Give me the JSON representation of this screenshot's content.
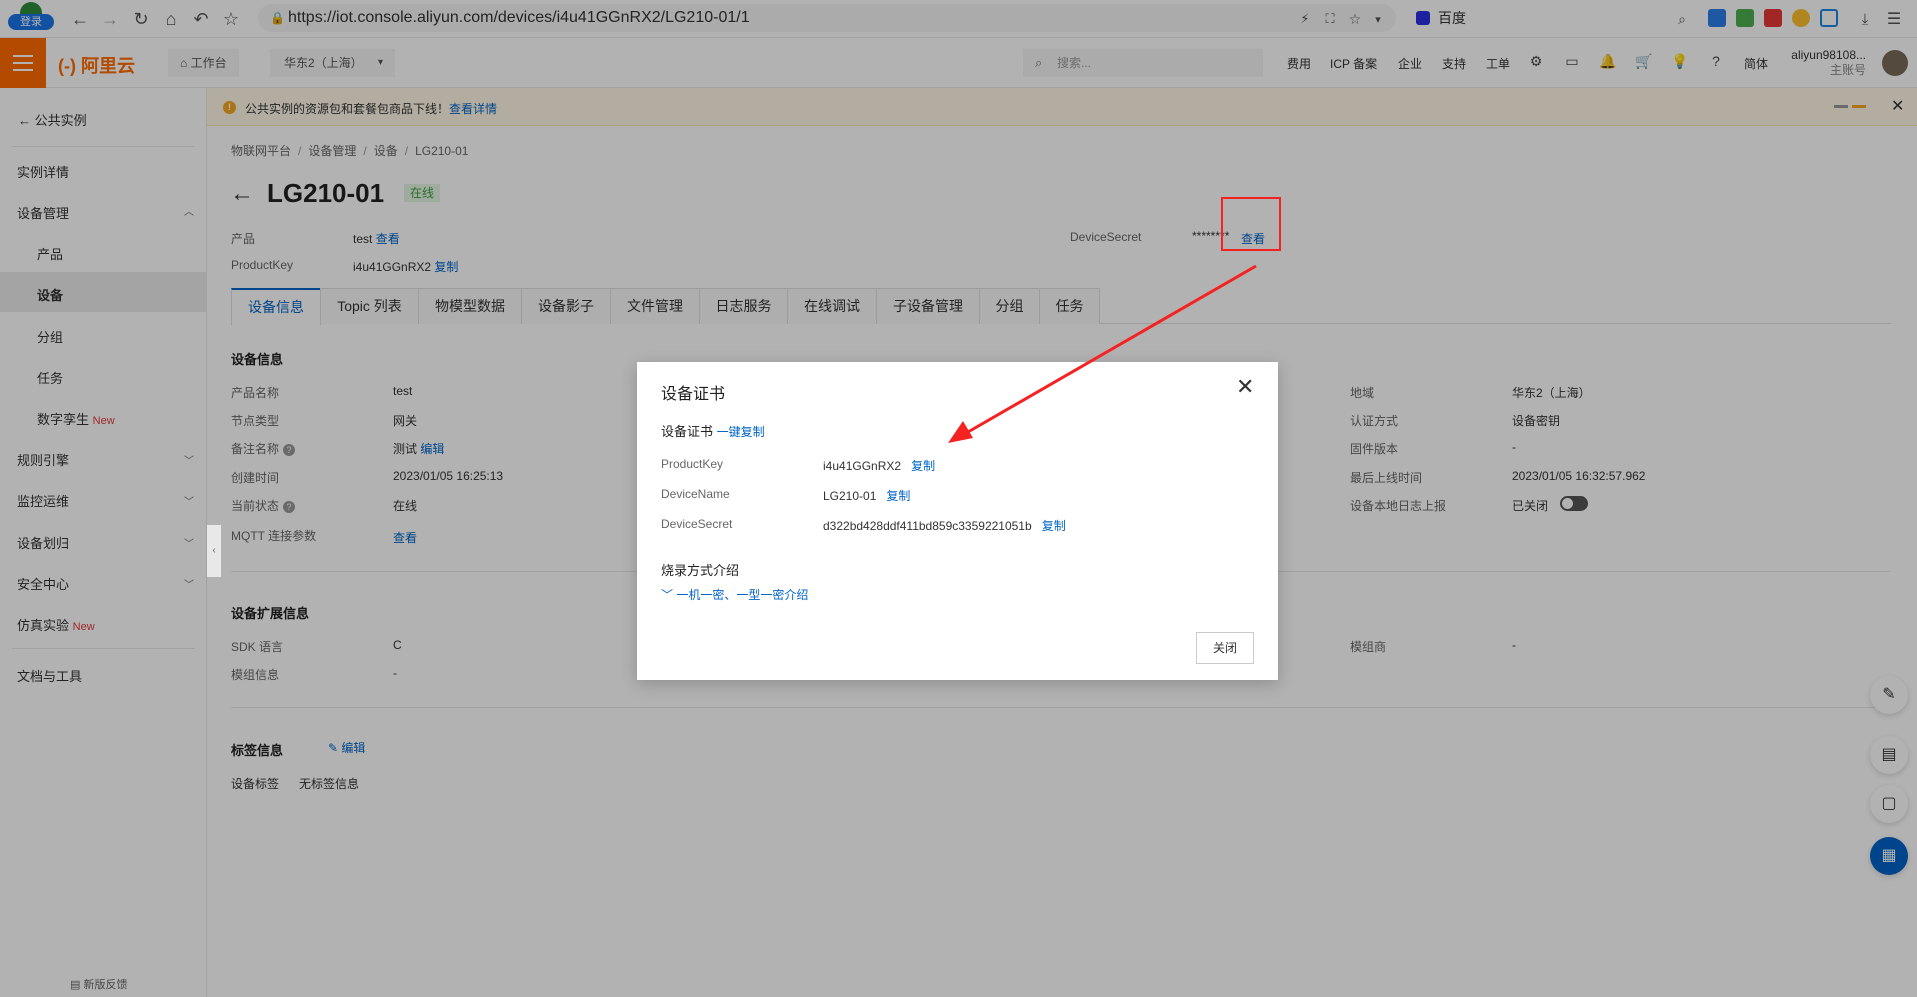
{
  "browser": {
    "ext_badge": "登录",
    "url": "https://iot.console.aliyun.com/devices/i4u41GGnRX2/LG210-01/1",
    "search_engine": "百度"
  },
  "topnav": {
    "logo": "(-) 阿里云",
    "workbench": "工作台",
    "region": "华东2（上海）",
    "search_placeholder": "搜索...",
    "items": [
      "费用",
      "ICP 备案",
      "企业",
      "支持",
      "工单"
    ],
    "lang": "简体",
    "username": "aliyun98108...",
    "account_type": "主账号"
  },
  "sidebar": {
    "back": "公共实例",
    "instance_detail": "实例详情",
    "device_mgmt": "设备管理",
    "product": "产品",
    "device": "设备",
    "group": "分组",
    "task": "任务",
    "digital_twin": "数字孪生",
    "new_badge": "New",
    "rule_engine": "规则引擎",
    "monitor_ops": "监控运维",
    "device_assign": "设备划归",
    "security": "安全中心",
    "sim_lab": "仿真实验",
    "docs": "文档与工具",
    "feedback": "新版反馈"
  },
  "notice": {
    "text": "公共实例的资源包和套餐包商品下线！",
    "link": "查看详情"
  },
  "breadcrumb": [
    "物联网平台",
    "设备管理",
    "设备",
    "LG210-01"
  ],
  "device": {
    "name": "LG210-01",
    "status": "在线",
    "product_label": "产品",
    "product_value": "test",
    "view": "查看",
    "productkey_label": "ProductKey",
    "productkey_value": "i4u41GGnRX2",
    "copy": "复制",
    "secret_label": "DeviceSecret",
    "secret_masked": "********"
  },
  "tabs": [
    "设备信息",
    "Topic 列表",
    "物模型数据",
    "设备影子",
    "文件管理",
    "日志服务",
    "在线调试",
    "子设备管理",
    "分组",
    "任务"
  ],
  "info": {
    "title": "设备信息",
    "product_name_label": "产品名称",
    "product_name": "test",
    "node_type_label": "节点类型",
    "node_type": "网关",
    "remark_label": "备注名称",
    "remark": "测试",
    "edit": "编辑",
    "created_label": "创建时间",
    "created": "2023/01/05 16:25:13",
    "state_label": "当前状态",
    "state": "在线",
    "mqtt_label": "MQTT 连接参数",
    "mqtt_view": "查看",
    "region_label": "地域",
    "region": "华东2（上海）",
    "auth_label": "认证方式",
    "auth": "设备密钥",
    "firmware_label": "固件版本",
    "firmware": "-",
    "last_online_label": "最后上线时间",
    "last_online": "2023/01/05 16:32:57.962",
    "local_log_label": "设备本地日志上报",
    "local_log": "已关闭"
  },
  "ext": {
    "title": "设备扩展信息",
    "sdk_label": "SDK 语言",
    "sdk": "C",
    "module_info_label": "模组信息",
    "module_info": "-",
    "module_vendor_label": "模组商",
    "module_vendor": "-"
  },
  "tags": {
    "title": "标签信息",
    "edit": "编辑",
    "device_tag_label": "设备标签",
    "device_tag": "无标签信息"
  },
  "dialog": {
    "title": "设备证书",
    "subtitle": "设备证书",
    "copy_all": "一键复制",
    "pk_label": "ProductKey",
    "pk": "i4u41GGnRX2",
    "dn_label": "DeviceName",
    "dn": "LG210-01",
    "ds_label": "DeviceSecret",
    "ds": "d322bd428ddf411bd859c3359221051b",
    "copy": "复制",
    "burn_title": "烧录方式介绍",
    "burn_link": "一机一密、一型一密介绍",
    "close": "关闭"
  },
  "colors": {
    "brand": "#ff6a00",
    "link": "#0064c8",
    "annotation": "#f52222"
  }
}
